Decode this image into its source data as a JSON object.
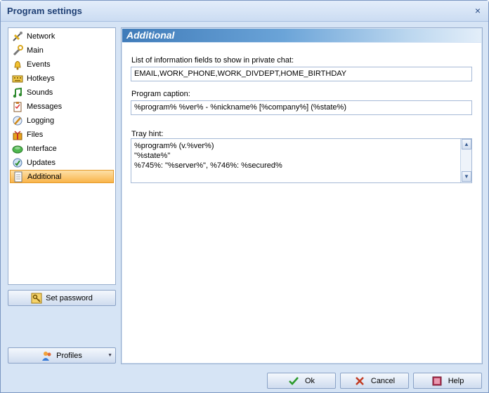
{
  "window": {
    "title": "Program settings",
    "close_glyph": "×"
  },
  "sidebar": {
    "items": [
      {
        "label": "Network",
        "icon": "network-icon"
      },
      {
        "label": "Main",
        "icon": "wrench-icon"
      },
      {
        "label": "Events",
        "icon": "bell-icon"
      },
      {
        "label": "Hotkeys",
        "icon": "keyboard-icon"
      },
      {
        "label": "Sounds",
        "icon": "music-note-icon"
      },
      {
        "label": "Messages",
        "icon": "clipboard-icon"
      },
      {
        "label": "Logging",
        "icon": "pencil-icon"
      },
      {
        "label": "Files",
        "icon": "gift-box-icon"
      },
      {
        "label": "Interface",
        "icon": "interface-icon"
      },
      {
        "label": "Updates",
        "icon": "updates-icon"
      },
      {
        "label": "Additional",
        "icon": "document-icon",
        "selected": true
      }
    ],
    "set_password_label": "Set password",
    "profiles_label": "Profiles"
  },
  "section": {
    "title": "Additional"
  },
  "fields": {
    "info_label": "List of information fields to show in private chat:",
    "info_value": "EMAIL,WORK_PHONE,WORK_DIVDEPT,HOME_BIRTHDAY",
    "caption_label": "Program caption:",
    "caption_value": "%program% %ver% - %nickname% [%company%] (%state%)",
    "tray_label": "Tray hint:",
    "tray_lines": [
      "%program% (v.%ver%)",
      "\"%state%\"",
      "%745%: \"%server%\", %746%: %secured%"
    ]
  },
  "buttons": {
    "ok": "Ok",
    "cancel": "Cancel",
    "help": "Help"
  },
  "colors": {
    "accent": "#3f7bb9",
    "selection": "#f9b44a",
    "window_bg": "#d6e4f5"
  }
}
